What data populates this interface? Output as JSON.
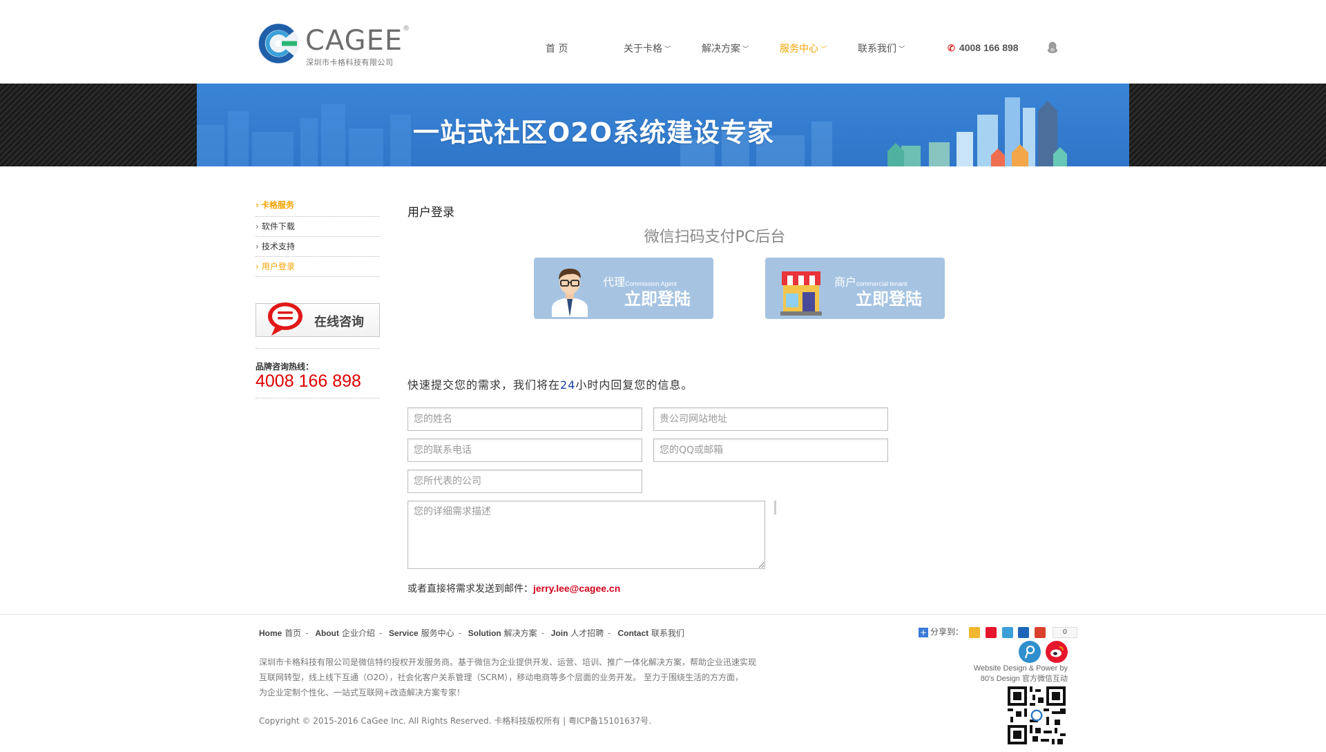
{
  "brand": {
    "name": "CAGEE",
    "tagline": "深圳市卡格科技有限公司",
    "colors": {
      "accent": "#f5a300",
      "banner_blue": "#3a84d6",
      "hotline_red": "#e00000",
      "card_blue": "#a6c4e2"
    }
  },
  "nav": {
    "items": [
      {
        "label": "首 页",
        "dropdown": false,
        "active": false
      },
      {
        "label": "关于卡格",
        "dropdown": true,
        "active": false
      },
      {
        "label": "解决方案",
        "dropdown": true,
        "active": false
      },
      {
        "label": "服务中心",
        "dropdown": true,
        "active": true
      },
      {
        "label": "联系我们",
        "dropdown": true,
        "active": false
      }
    ],
    "phone": "4008 166 898",
    "phone_icon": "phone-icon",
    "qq_icon": "qq-penguin-icon"
  },
  "banner": {
    "title": "一站式社区O2O系统建设专家"
  },
  "sidebar": {
    "heading": "卡格服务",
    "links": [
      {
        "label": "软件下载",
        "active": false
      },
      {
        "label": "技术支持",
        "active": false
      },
      {
        "label": "用户登录",
        "active": true
      }
    ],
    "consult_label": "在线咨询",
    "hotline_label": "品牌咨询热线：",
    "hotline_number": "4008 166 898"
  },
  "main": {
    "page_title": "用户登录",
    "qr_title": "微信扫码支付PC后台",
    "cards": [
      {
        "role": "代理",
        "role_en": "Commission Agent",
        "cta": "立即登陆",
        "icon": "agent-avatar-icon"
      },
      {
        "role": "商户",
        "role_en": "commercial tenant",
        "cta": "立即登陆",
        "icon": "storefront-icon"
      }
    ],
    "form": {
      "intro_before": "快速提交您的需求，我们将在",
      "intro_hours": "24",
      "intro_after": "小时内回复您的信息。",
      "placeholders": {
        "name": "您的姓名",
        "website": "贵公司网站地址",
        "phone": "您的联系电话",
        "qq_email": "您的QQ或邮箱",
        "company": "您所代表的公司",
        "description": "您的详细需求描述"
      },
      "email_label": "或者直接将需求发送到邮件：",
      "email": "jerry.lee@cagee.cn"
    }
  },
  "footer": {
    "nav": [
      {
        "en": "Home",
        "zh": "首页"
      },
      {
        "en": "About",
        "zh": "企业介绍"
      },
      {
        "en": "Service",
        "zh": "服务中心"
      },
      {
        "en": "Solution",
        "zh": "解决方案"
      },
      {
        "en": "Join",
        "zh": "人才招聘"
      },
      {
        "en": "Contact",
        "zh": "联系我们"
      }
    ],
    "nav_separator": "-",
    "desc_lines": [
      "深圳市卡格科技有限公司是微信特约授权开发服务商。基于微信为企业提供开发、运营、培训、推广一体化解决方案，帮助企业迅速实现",
      "互联网转型，线上线下互通（O2O），社会化客户关系管理（SCRM），移动电商等多个层面的业务开发。 至力于围绕生活的方方面，",
      "为企业定制个性化、一站式互联网+改造解决方案专家！"
    ],
    "copyright": "Copyright © 2015-2016 CaGee Inc. All Rights Reserved. 卡格科技版权所有 | 粤ICP备15101637号.",
    "share_label": "分享到：",
    "share_count": "0",
    "share_icons": [
      "qzone-icon",
      "sina-weibo-icon",
      "tencent-weibo-icon",
      "renren-icon",
      "kaixin-icon"
    ],
    "credit_line1": "Website Design & Power by",
    "credit_line2": "80's Design 官方微信互动",
    "social_icons": [
      "tencent-weibo-round-icon",
      "sina-weibo-round-icon"
    ],
    "qr_icon": "qr-code-icon"
  }
}
